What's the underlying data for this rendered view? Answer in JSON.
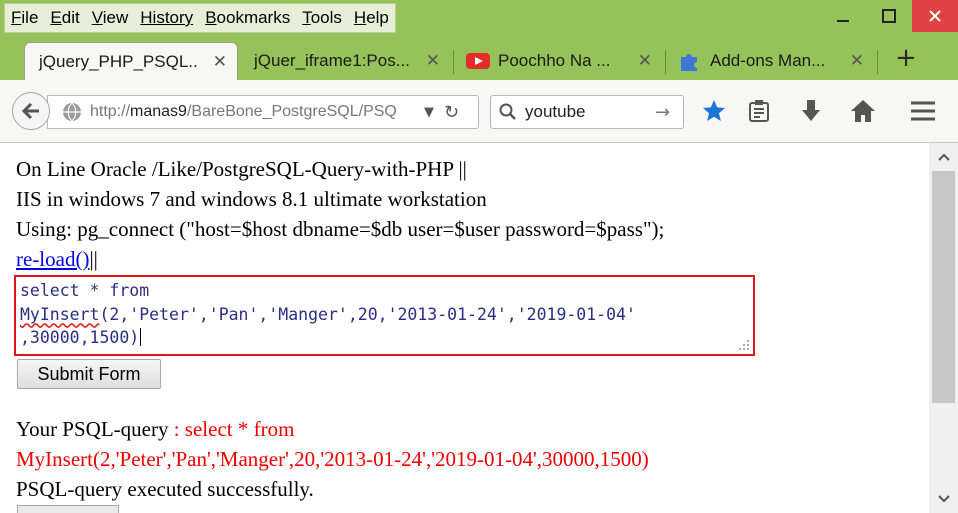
{
  "menubar": {
    "items": [
      {
        "label": "File",
        "accel": "F",
        "rest": "ile"
      },
      {
        "label": "Edit",
        "accel": "E",
        "rest": "dit"
      },
      {
        "label": "View",
        "accel": "V",
        "rest": "iew"
      },
      {
        "label": "History",
        "accel": "",
        "rest": "History"
      },
      {
        "label": "Bookmarks",
        "accel": "B",
        "rest": "ookmarks"
      },
      {
        "label": "Tools",
        "accel": "T",
        "rest": "ools"
      },
      {
        "label": "Help",
        "accel": "H",
        "rest": "elp"
      }
    ]
  },
  "tabs": [
    {
      "label": "jQuery_PHP_PSQL...",
      "active": true
    },
    {
      "label": "jQuer_iframe1:Pos...",
      "active": false
    },
    {
      "label": "Poochho Na ...",
      "active": false,
      "icon": "youtube-icon"
    },
    {
      "label": "Add-ons Man...",
      "active": false,
      "icon": "puzzle-icon"
    }
  ],
  "new_tab_label": "+",
  "urlbar": {
    "prefix": "http://",
    "host": "manas9",
    "path": "/BareBone_PostgreSQL/PSQ"
  },
  "searchbar": {
    "value": "youtube"
  },
  "page": {
    "heading_line1": "On Line Oracle /Like/PostgreSQL-Query-with-PHP ||",
    "heading_line2": "IIS in windows 7 and windows 8.1 ultimate workstation",
    "heading_line3": "Using: pg_connect (\"host=$host dbname=$db user=$user password=$pass\");",
    "reload_link": "re-load()",
    "reload_suffix": "||",
    "query_line1": "select * from",
    "query_line2a": "MyInsert",
    "query_line2b": "(2,'Peter','Pan','Manger',20,'2013-01-24','2019-01-04'",
    "query_line3": ",30000,1500)",
    "submit_label": "Submit Form",
    "result_label": "Your PSQL-query ",
    "result_query_part1": ": select * from",
    "result_query_part2": "MyInsert(2,'Peter','Pan','Manger',20,'2013-01-24','2019-01-04',30000,1500)",
    "status_message": "PSQL-query executed successfully."
  },
  "colors": {
    "chrome_green": "#96c25a",
    "highlight_border": "#e0141b",
    "result_red": "#ee0000",
    "link_blue": "#0000ee"
  }
}
